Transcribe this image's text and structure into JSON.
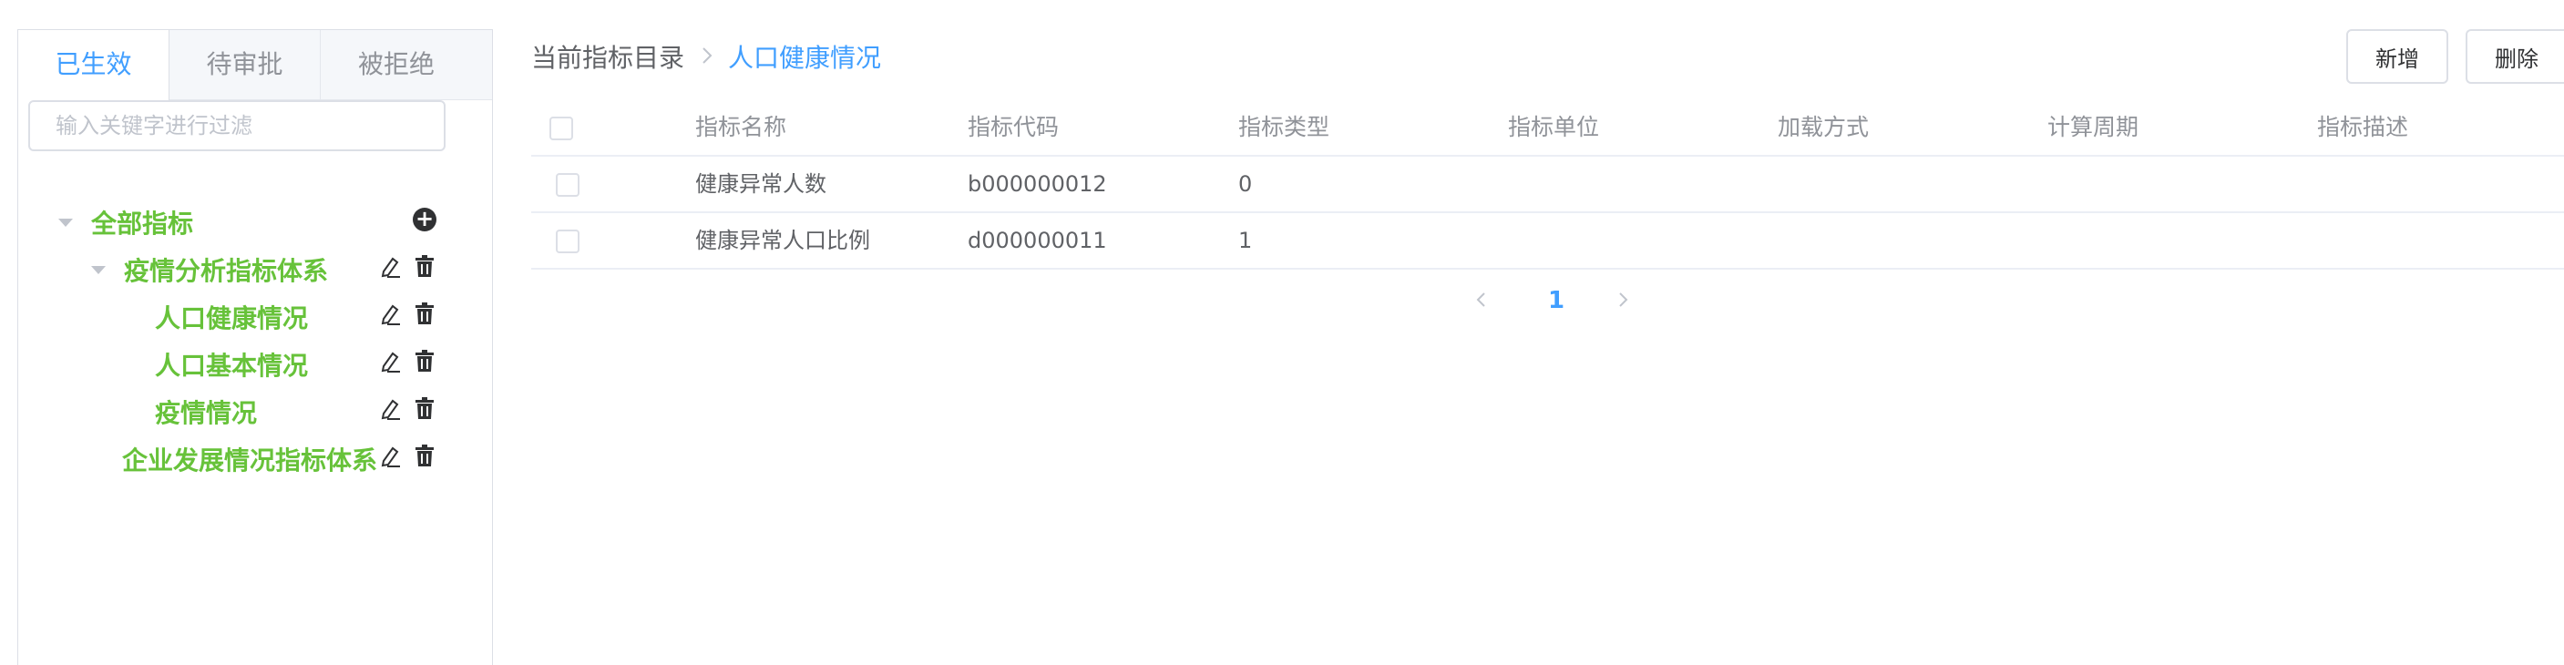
{
  "left_panel": {
    "tabs": [
      {
        "label": "已生效"
      },
      {
        "label": "待审批"
      },
      {
        "label": "被拒绝"
      }
    ],
    "filter_placeholder": "输入关键字进行过滤",
    "tree": {
      "root": "全部指标",
      "group1": "疫情分析指标体系",
      "group1_children": [
        "人口健康情况",
        "人口基本情况",
        "疫情情况"
      ],
      "group2": "企业发展情况指标体系"
    }
  },
  "breadcrumb": {
    "root": "当前指标目录",
    "separator": "›",
    "current": "人口健康情况"
  },
  "toolbar": {
    "add_label": "新增",
    "delete_label": "删除"
  },
  "table": {
    "columns": [
      "指标名称",
      "指标代码",
      "指标类型",
      "指标单位",
      "加载方式",
      "计算周期",
      "指标描述"
    ],
    "rows": [
      [
        "健康异常人数",
        "b000000012",
        "0",
        "",
        "",
        "",
        ""
      ],
      [
        "健康异常人口比例",
        "d000000011",
        "1",
        "",
        "",
        "",
        ""
      ]
    ]
  },
  "pagination": {
    "current_page": "1"
  },
  "colors": {
    "primary": "#409eff",
    "tree_text": "#67c23a",
    "border": "#dcdfe6"
  },
  "icons": {
    "tree_add": "plus-circle-icon",
    "tree_edit": "pencil-icon",
    "tree_delete": "trash-icon",
    "caret": "caret-down-icon"
  }
}
